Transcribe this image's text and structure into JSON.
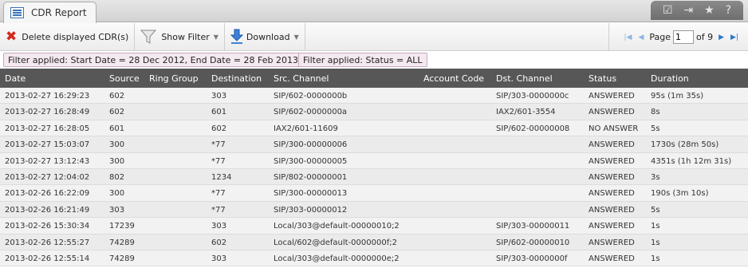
{
  "tab": {
    "title": "CDR Report"
  },
  "window_controls": [
    "☑",
    "⇥",
    "★",
    "?"
  ],
  "toolbar": {
    "delete_label": "Delete displayed CDR(s)",
    "filter_label": "Show Filter",
    "download_label": "Download"
  },
  "pager": {
    "page_label": "Page",
    "current_page": "1",
    "of_label": "of 9"
  },
  "filters": [
    "Filter applied: Start Date = 28 Dec 2012, End Date = 28 Feb 2013",
    "Filter applied: Status = ALL"
  ],
  "columns": [
    "Date",
    "Source",
    "Ring Group",
    "Destination",
    "Src. Channel",
    "Account Code",
    "Dst. Channel",
    "Status",
    "Duration"
  ],
  "rows": [
    {
      "date": "2013-02-27 16:29:23",
      "src": "602",
      "ring": "",
      "dst": "303",
      "schan": "SIP/602-0000000b",
      "acct": "",
      "dchan": "SIP/303-0000000c",
      "status": "ANSWERED",
      "dur": "95s (1m 35s)"
    },
    {
      "date": "2013-02-27 16:28:49",
      "src": "602",
      "ring": "",
      "dst": "601",
      "schan": "SIP/602-0000000a",
      "acct": "",
      "dchan": "IAX2/601-3554",
      "status": "ANSWERED",
      "dur": "8s"
    },
    {
      "date": "2013-02-27 16:28:05",
      "src": "601",
      "ring": "",
      "dst": "602",
      "schan": "IAX2/601-11609",
      "acct": "",
      "dchan": "SIP/602-00000008",
      "status": "NO ANSWER",
      "dur": "5s"
    },
    {
      "date": "2013-02-27 15:03:07",
      "src": "300",
      "ring": "",
      "dst": "*77",
      "schan": "SIP/300-00000006",
      "acct": "",
      "dchan": "",
      "status": "ANSWERED",
      "dur": "1730s (28m 50s)"
    },
    {
      "date": "2013-02-27 13:12:43",
      "src": "300",
      "ring": "",
      "dst": "*77",
      "schan": "SIP/300-00000005",
      "acct": "",
      "dchan": "",
      "status": "ANSWERED",
      "dur": "4351s (1h 12m 31s)"
    },
    {
      "date": "2013-02-27 12:04:02",
      "src": "802",
      "ring": "",
      "dst": "1234",
      "schan": "SIP/802-00000001",
      "acct": "",
      "dchan": "",
      "status": "ANSWERED",
      "dur": "3s"
    },
    {
      "date": "2013-02-26 16:22:09",
      "src": "300",
      "ring": "",
      "dst": "*77",
      "schan": "SIP/300-00000013",
      "acct": "",
      "dchan": "",
      "status": "ANSWERED",
      "dur": "190s (3m 10s)"
    },
    {
      "date": "2013-02-26 16:21:49",
      "src": "303",
      "ring": "",
      "dst": "*77",
      "schan": "SIP/303-00000012",
      "acct": "",
      "dchan": "",
      "status": "ANSWERED",
      "dur": "5s"
    },
    {
      "date": "2013-02-26 15:30:34",
      "src": "17239",
      "ring": "",
      "dst": "303",
      "schan": "Local/303@default-00000010;2",
      "acct": "",
      "dchan": "SIP/303-00000011",
      "status": "ANSWERED",
      "dur": "1s"
    },
    {
      "date": "2013-02-26 12:55:27",
      "src": "74289",
      "ring": "",
      "dst": "602",
      "schan": "Local/602@default-0000000f;2",
      "acct": "",
      "dchan": "SIP/602-00000010",
      "status": "ANSWERED",
      "dur": "1s"
    },
    {
      "date": "2013-02-26 12:55:14",
      "src": "74289",
      "ring": "",
      "dst": "303",
      "schan": "Local/303@default-0000000e;2",
      "acct": "",
      "dchan": "SIP/303-0000000f",
      "status": "ANSWERED",
      "dur": "1s"
    }
  ]
}
